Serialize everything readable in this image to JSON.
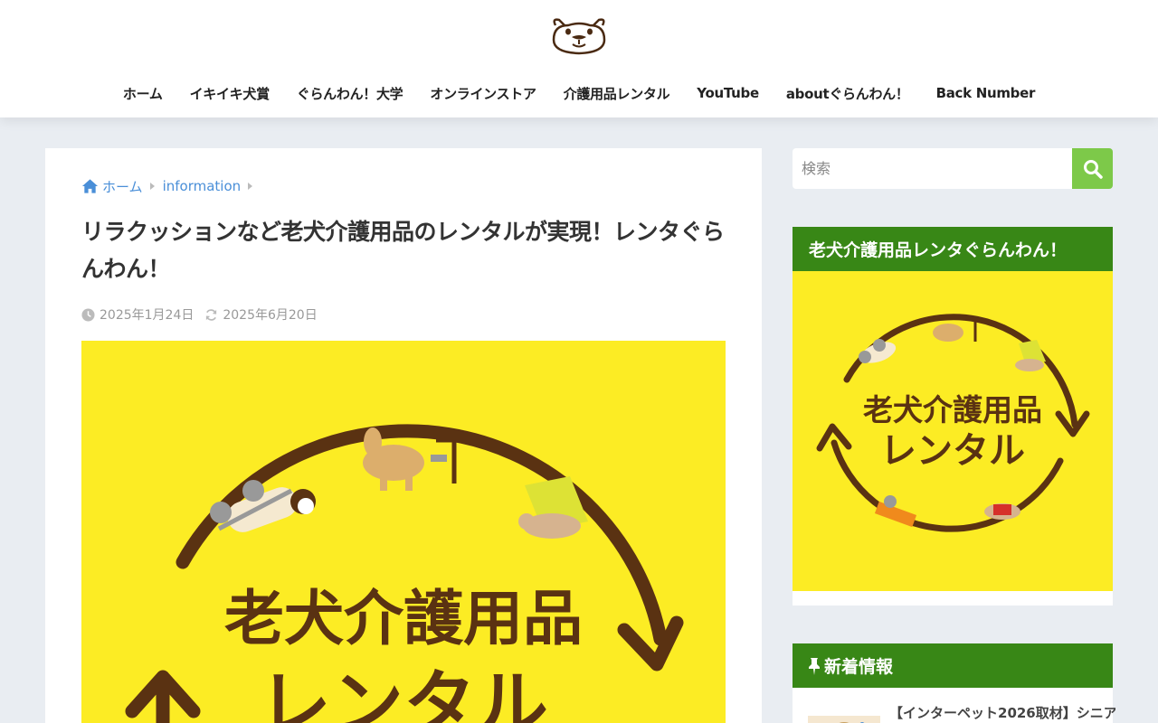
{
  "header": {
    "nav": [
      {
        "label": "ホーム"
      },
      {
        "label": "イキイキ犬賞"
      },
      {
        "label": "ぐらんわん！大学"
      },
      {
        "label": "オンラインストア"
      },
      {
        "label": "介護用品レンタル"
      },
      {
        "label": "YouTube"
      },
      {
        "label": "aboutぐらんわん！"
      },
      {
        "label": "Back Number"
      }
    ]
  },
  "breadcrumb": {
    "home": "ホーム",
    "category": "information"
  },
  "article": {
    "title": "リラクッションなど老犬介護用品のレンタルが実現！レンタぐらんわん！",
    "published": "2025年1月24日",
    "updated": "2025年6月20日",
    "eyecatch_text_line1": "老犬介護用品",
    "eyecatch_text_line2": "レンタル"
  },
  "sidebar": {
    "search_placeholder": "検索",
    "widget_title": "老犬介護用品レンタぐらんわん！",
    "widget_img_line1": "老犬介護用品",
    "widget_img_line2": "レンタル",
    "news_title": "新着情報",
    "news_item": "【インターペット2026取材】シニア"
  },
  "colors": {
    "brand_green": "#388716",
    "search_green": "#7dc949",
    "yellow": "#fcec24",
    "brown": "#5a3212",
    "link": "#4a8fd8"
  }
}
